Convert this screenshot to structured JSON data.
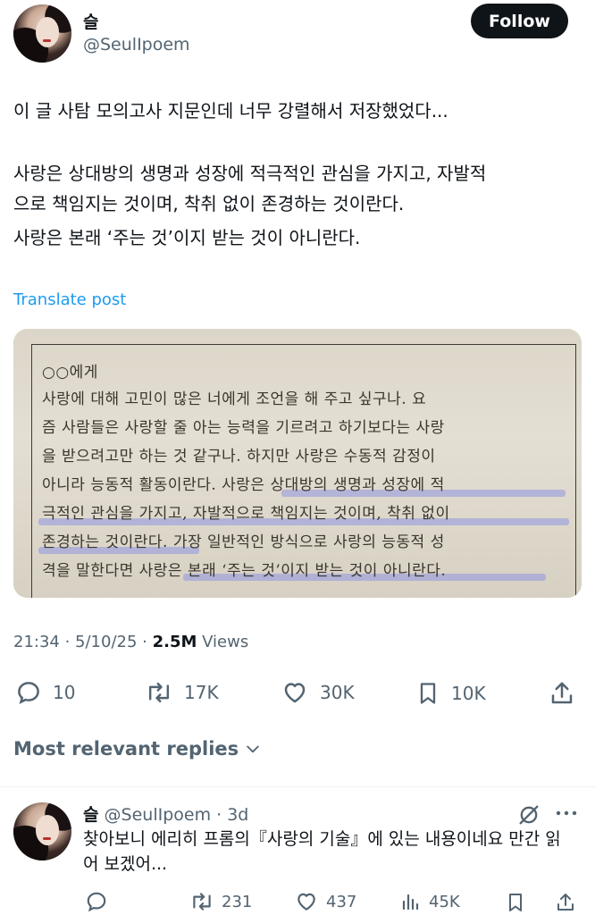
{
  "post": {
    "author_name": "슬",
    "author_handle": "@SeulIpoem",
    "follow_label": "Follow",
    "text_lines": [
      "이 글 사탐 모의고사 지문인데 너무 강렬해서 저장했었다...",
      "사랑은 상대방의 생명과 성장에 적극적인 관심을 가지고, 자발적",
      "으로 책임지는 것이며, 착취 없이 존경하는 것이란다.",
      "사랑은 본래 ‘주는 것’이지 받는 것이 아니란다."
    ],
    "translate_label": "Translate post",
    "media_text": [
      "○○에게",
      "  사랑에 대해 고민이 많은 너에게 조언을 해 주고 싶구나. 요",
      "즘 사람들은 사랑할 줄 아는 능력을 기르려고 하기보다는 사랑",
      "을 받으려고만 하는 것 같구나. 하지만 사랑은 수동적 감정이",
      "아니라 능동적 활동이란다. 사랑은 상대방의 생명과 성장에 적",
      "극적인 관심을 가지고, 자발적으로 책임지는 것이며, 착취 없이",
      "존경하는 것이란다. 가장 일반적인 방식으로 사랑의 능동적 성",
      "격을 말한다면 사랑은 본래 ‘주는 것’이지 받는 것이 아니란다."
    ],
    "time": "21:34 · 5/10/25 · ",
    "views_count": "2.5M",
    "views_label": " Views",
    "stats": {
      "replies": "10",
      "reposts": "17K",
      "likes": "30K",
      "bookmarks": "10K"
    },
    "icons": [
      "reply-icon",
      "repost-icon",
      "like-icon",
      "bookmark-icon",
      "share-icon"
    ]
  },
  "replies_sort_label": "Most relevant replies",
  "reply": {
    "author_name": "슬",
    "author_handle": "@SeulIpoem",
    "separator": " · ",
    "time": "3d",
    "text_lines": [
      "찾아보니 에리히 프롬의『사랑의 기술』에 있는 내용이네요 만간 읽",
      "어 보겠어..."
    ],
    "stats": {
      "replies": "",
      "reposts": "231",
      "likes": "437",
      "views": "45K"
    }
  },
  "colors": {
    "text": "#0f1419",
    "secondary": "#536471",
    "link": "#1d9bf0",
    "highlight": "#8e96e2"
  }
}
